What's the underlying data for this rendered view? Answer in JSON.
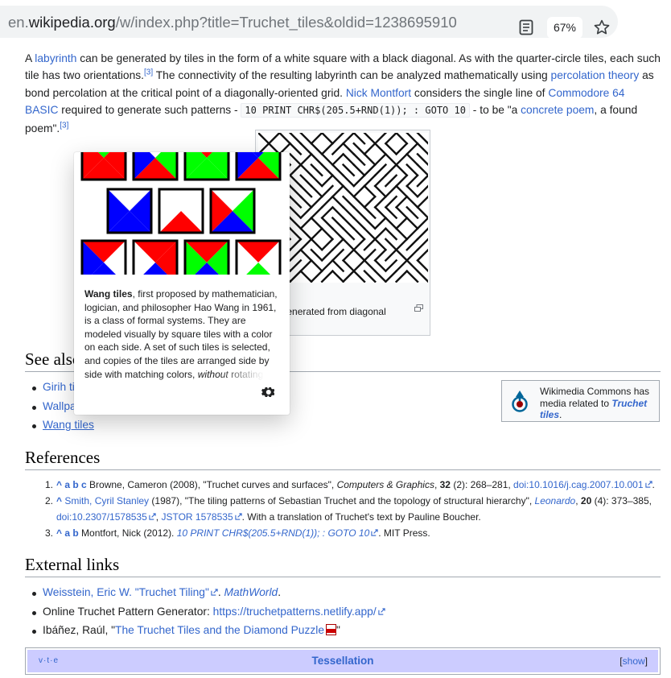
{
  "browser": {
    "url_prefix": "en.",
    "url_domain": "wikipedia.org",
    "url_path": "/w/index.php?title=Truchet_tiles&oldid=1238695910",
    "zoom": "67%"
  },
  "intro": {
    "t1": "A ",
    "labyrinth": "labyrinth",
    "t2": " can be generated by tiles in the form of a white square with a black diagonal. As with the quarter-circle tiles, each such tile has two orientations.",
    "ref1": "[3]",
    "t3": " The connectivity of the resulting labyrinth can be analyzed mathematically using ",
    "percolation": "percolation theory",
    "t4": " as bond percolation at the critical point of a diagonally-oriented grid. ",
    "montfort": "Nick Montfort",
    "t5": " considers the single line of ",
    "c64": "Commodore 64 BASIC",
    "t6": " required to generate such patterns - ",
    "code": "10 PRINT CHR$(205.5+RND(1)); : GOTO 10",
    "t7": " - to be \"a ",
    "concrete": "concrete poem",
    "t8": ", a found poem\".",
    "ref2": "[3]"
  },
  "thumb": {
    "caption": "rinth generated from diagonal"
  },
  "see_also": {
    "heading": "See also",
    "items": [
      "Girih tiles",
      "Wallpaper group",
      "Wang tiles"
    ]
  },
  "commons": {
    "line1": "Wikimedia Commons has media related to ",
    "link": "Truchet tiles",
    "end": "."
  },
  "references": {
    "heading": "References",
    "items": [
      {
        "num": "1.",
        "carets": "^ a b c",
        "t1": " Browne, Cameron (2008), \"Truchet curves and surfaces\", ",
        "journal": "Computers & Graphics",
        "vol": "32",
        "t2": " (2): 268–281, ",
        "doi": "doi:10.1016/j.cag.2007.10.001",
        "end": "."
      },
      {
        "num": "2.",
        "carets": "^",
        "author": "Smith, Cyril Stanley",
        "t1": " (1987), \"The tiling patterns of Sebastian Truchet and the topology of structural hierarchy\", ",
        "journal": "Leonardo",
        "t2": ", ",
        "vol": "20",
        "t3": " (4): 373–385, ",
        "doi": "doi:10.2307/1578535",
        "t4": ", ",
        "jstor": "JSTOR 1578535",
        "t5": ". With a translation of Truchet's text by Pauline Boucher."
      },
      {
        "num": "3.",
        "carets": "^ a b",
        "t1": " Montfort, Nick (2012). ",
        "book": "10 PRINT CHR$(205.5+RND(1)); : GOTO 10",
        "t2": ". MIT Press."
      }
    ]
  },
  "external": {
    "heading": "External links",
    "i1_link": "Weisstein, Eric W. \"Truchet Tiling\"",
    "i1_sep": ". ",
    "i1_site": "MathWorld",
    "i1_end": ".",
    "i2_text": "Online Truchet Pattern Generator: ",
    "i2_link": "https://truchetpatterns.netlify.app/",
    "i3_text": "Ibáñez, Raúl, \"",
    "i3_link": "The Truchet Tiles and the Diamond Puzzle",
    "i3_end": "\""
  },
  "navbox": {
    "vte": "v·t·e",
    "title": "Tessellation",
    "show": "show",
    "lb": "[",
    "rb": "]"
  },
  "popup": {
    "bold": "Wang tiles",
    "text": ", first proposed by mathematician, logician, and philosopher Hao Wang in 1961, is a class of formal systems. They are modeled visually by square tiles with a color on each side. A set of such tiles is selected, and copies of the tiles are arranged side by side with matching colors, ",
    "italic": "without",
    "tail": " rotating"
  },
  "colors": {
    "link": "#3366cc",
    "wang_red": "#ff0000",
    "wang_green": "#00ff00",
    "wang_blue": "#0000ff",
    "navbox": "#ccccff"
  }
}
